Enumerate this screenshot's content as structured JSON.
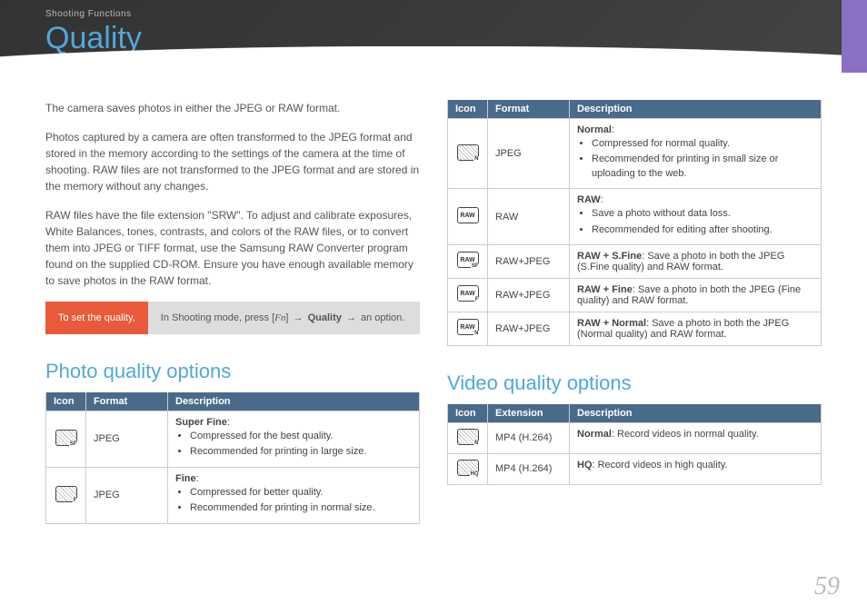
{
  "breadcrumb": "Shooting Functions",
  "title": "Quality",
  "intro": {
    "p1": "The camera saves photos in either the JPEG or RAW format.",
    "p2": "Photos captured by a camera are often transformed to the JPEG format and stored in the memory according to the settings of the camera at the time of shooting. RAW files are not transformed to the JPEG format and are stored in the memory without any changes.",
    "p3": "RAW files have the file extension \"SRW\". To adjust and calibrate exposures, White Balances, tones, contrasts, and colors of the RAW files, or to convert them into JPEG or TIFF format, use the Samsung RAW Converter program found on the supplied CD-ROM. Ensure you have enough available memory to save photos in the RAW format."
  },
  "instruction": {
    "label": "To set the quality,",
    "prefix": "In Shooting mode, press [",
    "fn": "Fn",
    "mid1": "] ",
    "arrow": "→",
    "quality": "Quality",
    "suffix": " an option."
  },
  "photo_section_title": "Photo quality options",
  "video_section_title": "Video quality options",
  "headers": {
    "icon": "Icon",
    "format": "Format",
    "ext": "Extension",
    "desc": "Description"
  },
  "photo_rows": [
    {
      "icon_sub": "SF",
      "icon_style": "hatch",
      "format": "JPEG",
      "lead": "Super Fine",
      "bullets": [
        "Compressed for the best quality.",
        "Recommended for printing in large size."
      ]
    },
    {
      "icon_sub": "F",
      "icon_style": "hatch",
      "format": "JPEG",
      "lead": "Fine",
      "bullets": [
        "Compressed for better quality.",
        "Recommended for printing in normal size."
      ]
    },
    {
      "icon_sub": "N",
      "icon_style": "hatch",
      "format": "JPEG",
      "lead": "Normal",
      "bullets": [
        "Compressed for normal quality.",
        "Recommended for printing in small size or uploading to the web."
      ]
    },
    {
      "icon_text": "RAW",
      "icon_style": "plain",
      "format": "RAW",
      "lead": "RAW",
      "bullets": [
        "Save a photo without data loss.",
        "Recommended for editing after shooting."
      ]
    },
    {
      "icon_text": "RAW",
      "icon_sub": "SF",
      "icon_style": "plain",
      "format": "RAW+JPEG",
      "inline_lead": "RAW + S.Fine",
      "inline_rest": ": Save a photo in both the JPEG (S.Fine quality) and RAW format."
    },
    {
      "icon_text": "RAW",
      "icon_sub": "F",
      "icon_style": "plain",
      "format": "RAW+JPEG",
      "inline_lead": "RAW + Fine",
      "inline_rest": ": Save a photo in both the JPEG (Fine quality) and RAW format."
    },
    {
      "icon_text": "RAW",
      "icon_sub": "N",
      "icon_style": "plain",
      "format": "RAW+JPEG",
      "inline_lead": "RAW + Normal",
      "inline_rest": ": Save a photo in both the JPEG (Normal quality) and RAW format."
    }
  ],
  "video_rows": [
    {
      "icon_sub": "N",
      "icon_style": "hatch",
      "ext": "MP4 (H.264)",
      "inline_lead": "Normal",
      "inline_rest": ": Record videos in normal quality."
    },
    {
      "icon_sub": "HQ",
      "icon_style": "hatch-lines",
      "ext": "MP4 (H.264)",
      "inline_lead": "HQ",
      "inline_rest": ": Record videos in high quality."
    }
  ],
  "page_number": "59"
}
